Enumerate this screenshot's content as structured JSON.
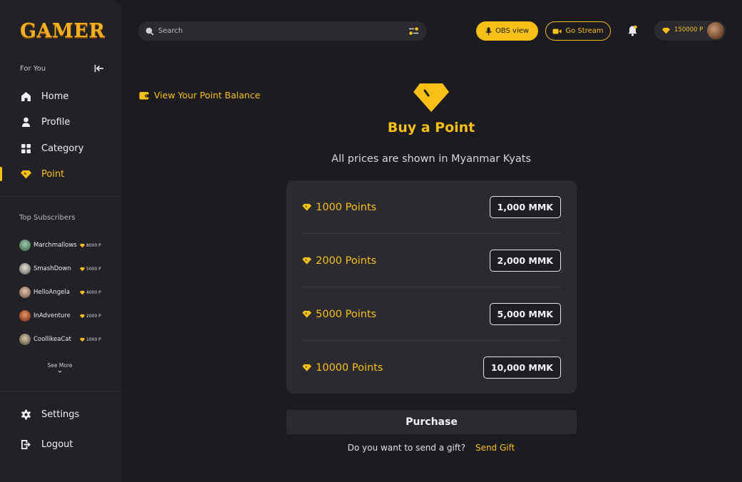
{
  "app": {
    "logo_text": "GAMER"
  },
  "sidebar": {
    "for_you_label": "For You",
    "nav": [
      {
        "label": "Home",
        "icon": "home-icon",
        "active": false
      },
      {
        "label": "Profile",
        "icon": "user-icon",
        "active": false
      },
      {
        "label": "Category",
        "icon": "grid-icon",
        "active": false
      },
      {
        "label": "Point",
        "icon": "gem-icon",
        "active": true
      }
    ],
    "top_subscribers_title": "Top Subscribers",
    "subscribers": [
      {
        "name": "Marchmallows",
        "points": "8000 P"
      },
      {
        "name": "SmashDown",
        "points": "5000 P"
      },
      {
        "name": "HelloAngela",
        "points": "4000 P"
      },
      {
        "name": "InAdventure",
        "points": "2000 P"
      },
      {
        "name": "CoollikeaCat",
        "points": "1000 P"
      }
    ],
    "see_more_label": "See More",
    "settings_label": "Settings",
    "logout_label": "Logout"
  },
  "topbar": {
    "search_placeholder": "Search",
    "obs_label": "OBS view",
    "stream_label": "Go Stream",
    "wallet_amount": "150000 P"
  },
  "main": {
    "balance_link": "View Your Point Balance",
    "title": "Buy a Point",
    "subtitle": "All prices are shown in Myanmar Kyats",
    "packages": [
      {
        "points": "1000 Points",
        "price": "1,000 MMK"
      },
      {
        "points": "2000 Points",
        "price": "2,000 MMK"
      },
      {
        "points": "5000 Points",
        "price": "5,000 MMK"
      },
      {
        "points": "10000 Points",
        "price": "10,000 MMK"
      }
    ],
    "purchase_label": "Purchase",
    "gift_question": "Do you want to send a gift?",
    "gift_link": "Send Gift"
  },
  "colors": {
    "accent": "#f8c014",
    "background": "#1c1c20",
    "panel": "#2a2a2f",
    "sidebar": "#222226"
  }
}
